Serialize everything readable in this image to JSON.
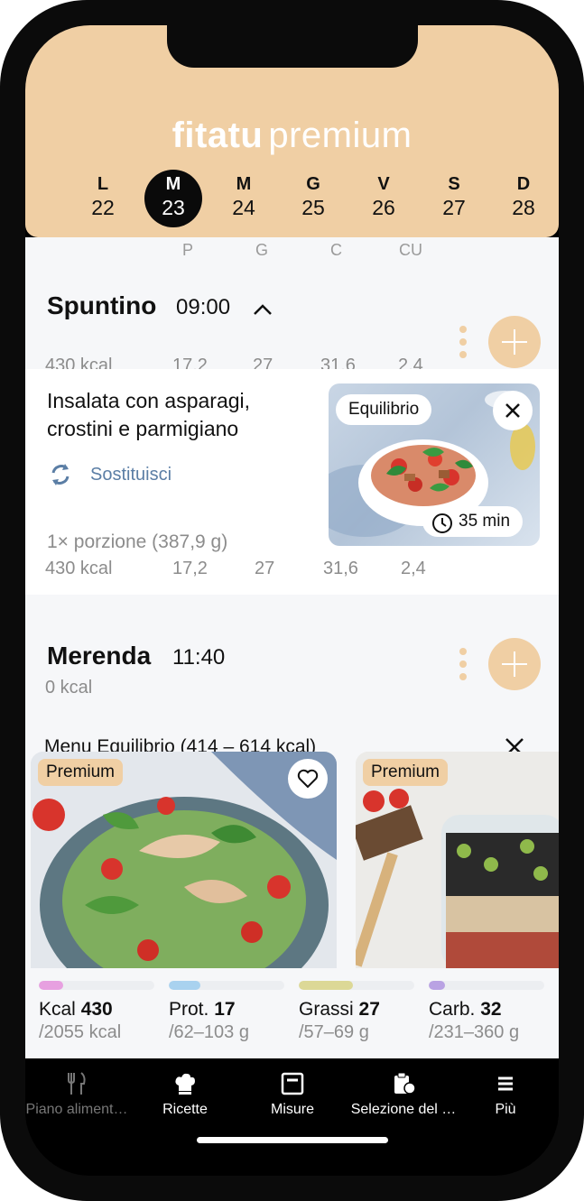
{
  "brand": {
    "name_bold": "fitatu",
    "name_light": "premium"
  },
  "calendar": {
    "days": [
      {
        "letter": "L",
        "num": "22",
        "selected": false
      },
      {
        "letter": "M",
        "num": "23",
        "selected": true
      },
      {
        "letter": "M",
        "num": "24",
        "selected": false
      },
      {
        "letter": "G",
        "num": "25",
        "selected": false
      },
      {
        "letter": "V",
        "num": "26",
        "selected": false
      },
      {
        "letter": "S",
        "num": "27",
        "selected": false
      },
      {
        "letter": "D",
        "num": "28",
        "selected": false
      }
    ]
  },
  "macro_headers": [
    "P",
    "G",
    "C",
    "CU"
  ],
  "meals": [
    {
      "title": "Spuntino",
      "time": "09:00",
      "kcal": "430 kcal",
      "macros": [
        "17,2",
        "27",
        "31,6",
        "2,4"
      ],
      "item": {
        "name": "Insalata con asparagi, crostini e parmigiano",
        "swap_label": "Sostituisci",
        "badge": "Equilibrio",
        "duration": "35 min",
        "portion": "1× porzione (387,9 g)",
        "kcal": "430 kcal",
        "macros": [
          "17,2",
          "27",
          "31,6",
          "2,4"
        ]
      }
    },
    {
      "title": "Merenda",
      "time": "11:40",
      "kcal": "0 kcal"
    }
  ],
  "menu_suggestion": {
    "label": "Menu Equilibrio (414 – 614 kcal)",
    "cards": [
      {
        "badge": "Premium"
      },
      {
        "badge": "Premium"
      }
    ]
  },
  "summary": {
    "kcal": {
      "label": "Kcal",
      "value": "430",
      "target": "/2055 kcal",
      "color": "#e7a0e0",
      "fill": 0.21
    },
    "prot": {
      "label": "Prot.",
      "value": "17",
      "target": "/62–103 g",
      "color": "#a9d2ef",
      "fill": 0.27
    },
    "fat": {
      "label": "Grassi",
      "value": "27",
      "target": "/57–69 g",
      "color": "#dcd896",
      "fill": 0.47
    },
    "carb": {
      "label": "Carb.",
      "value": "32",
      "target": "/231–360 g",
      "color": "#b9a2e3",
      "fill": 0.14
    }
  },
  "tabbar": {
    "items": [
      {
        "label": "Piano aliment…",
        "icon": "fork-knife-icon",
        "active": false
      },
      {
        "label": "Ricette",
        "icon": "chef-hat-icon",
        "active": true
      },
      {
        "label": "Misure",
        "icon": "scale-icon",
        "active": true
      },
      {
        "label": "Selezione del …",
        "icon": "clipboard-icon",
        "active": true
      },
      {
        "label": "Più",
        "icon": "menu-icon",
        "active": true
      }
    ]
  },
  "colors": {
    "accent": "#f0cfa4",
    "link": "#5b7ea5",
    "muted": "#8c8c8c"
  }
}
